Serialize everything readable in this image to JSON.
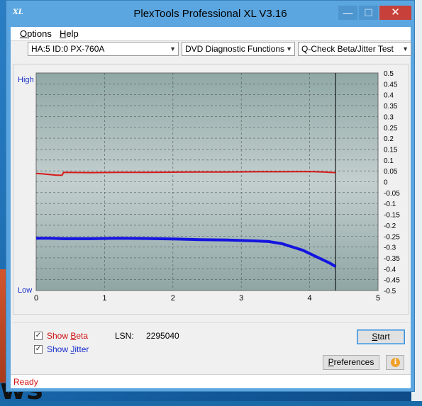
{
  "window": {
    "title": "PlexTools Professional XL V3.16",
    "app_icon_text": "XL",
    "min_glyph": "—",
    "max_glyph": "☐",
    "close_glyph": "✕"
  },
  "menu": {
    "options_first": "O",
    "options_rest": "ptions",
    "help_first": "H",
    "help_rest": "elp"
  },
  "toolbar": {
    "drive": "HA:5 ID:0  PX-760A",
    "function": "DVD Diagnostic Functions",
    "test": "Q-Check Beta/Jitter Test"
  },
  "chart_labels": {
    "high": "High",
    "low": "Low"
  },
  "chart_data": {
    "type": "line",
    "x_ticks": [
      "0",
      "1",
      "2",
      "3",
      "4",
      "5"
    ],
    "xlim": [
      0,
      5
    ],
    "y_ticks": [
      "0.5",
      "0.45",
      "0.4",
      "0.35",
      "0.3",
      "0.25",
      "0.2",
      "0.15",
      "0.1",
      "0.05",
      "0",
      "-0.05",
      "-0.1",
      "-0.15",
      "-0.2",
      "-0.25",
      "-0.3",
      "-0.35",
      "-0.4",
      "-0.45",
      "-0.5"
    ],
    "ylim": [
      -0.5,
      0.5
    ],
    "grid": true,
    "end_marker_x": 4.38,
    "series": [
      {
        "color": "#d81b1b",
        "x": [
          0.0,
          0.1,
          0.2,
          0.3,
          0.38,
          0.4,
          0.8,
          1.2,
          1.6,
          2.0,
          2.4,
          2.8,
          3.2,
          3.6,
          4.0,
          4.2,
          4.38
        ],
        "y": [
          0.038,
          0.036,
          0.033,
          0.03,
          0.03,
          0.043,
          0.042,
          0.043,
          0.043,
          0.044,
          0.045,
          0.045,
          0.046,
          0.046,
          0.047,
          0.045,
          0.042
        ]
      },
      {
        "color": "#1414e0",
        "x": [
          0.0,
          0.2,
          0.4,
          0.8,
          1.2,
          1.6,
          2.0,
          2.4,
          2.8,
          3.0,
          3.2,
          3.4,
          3.6,
          3.7,
          3.8,
          3.9,
          4.0,
          4.1,
          4.2,
          4.3,
          4.38
        ],
        "y": [
          -0.26,
          -0.26,
          -0.262,
          -0.262,
          -0.26,
          -0.261,
          -0.263,
          -0.266,
          -0.268,
          -0.27,
          -0.272,
          -0.275,
          -0.285,
          -0.295,
          -0.305,
          -0.315,
          -0.33,
          -0.345,
          -0.36,
          -0.375,
          -0.39
        ]
      }
    ]
  },
  "bottom": {
    "show_beta_first": "Show ",
    "show_beta_key": "B",
    "show_beta_rest": "eta",
    "show_jitter_first": "Show ",
    "show_jitter_key": "J",
    "show_jitter_rest": "itter",
    "lsn_label": "LSN:",
    "lsn_value": "2295040",
    "start_first": "S",
    "start_rest": "tart",
    "prefs_first": "P",
    "prefs_rest": "references",
    "info_glyph": "i",
    "check_glyph": "✓"
  },
  "status": {
    "text": "Ready"
  },
  "desktop": {
    "text": "ws"
  }
}
